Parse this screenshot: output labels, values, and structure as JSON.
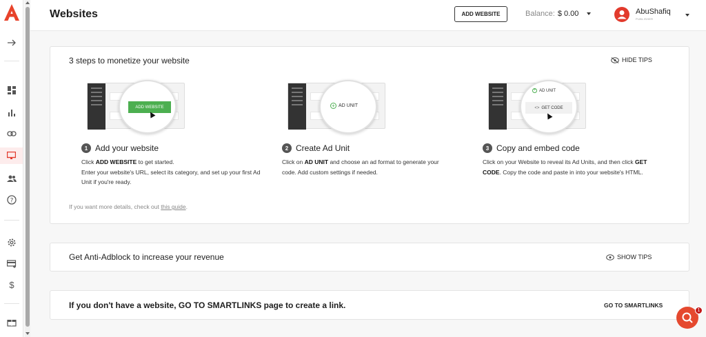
{
  "brand": {
    "logo_color": "#e8432b",
    "accent": "#e23a2c",
    "green": "#4caf50"
  },
  "sidebar": {
    "items": [
      {
        "icon": "arrow-right-icon"
      },
      {
        "icon": "dashboard-icon"
      },
      {
        "icon": "bar-chart-icon"
      },
      {
        "icon": "link-icon"
      },
      {
        "icon": "monitor-icon",
        "active": true
      },
      {
        "icon": "users-icon"
      },
      {
        "icon": "help-circle-icon"
      },
      {
        "icon": "gear-icon"
      },
      {
        "icon": "card-icon"
      },
      {
        "icon": "dollar-icon"
      },
      {
        "icon": "gift-icon"
      }
    ]
  },
  "header": {
    "title": "Websites",
    "add_website": "ADD WEBSITE",
    "balance_label": "Balance:",
    "balance_value": "$ 0.00",
    "user_name": "AbuShafiq",
    "user_role": "PUBLISHER"
  },
  "steps_card": {
    "title": "3 steps to monetize your website",
    "hide_tips": "HIDE TIPS",
    "steps": [
      {
        "num": "1",
        "title": "Add your website",
        "illus_label": "ADD WEBSITE",
        "line1_pre": "Click ",
        "line1_bold": "ADD WEBSITE",
        "line1_post": " to get started.",
        "line2": "Enter your website's URL, select its category, and set up your first Ad Unit if you're ready."
      },
      {
        "num": "2",
        "title": "Create Ad Unit",
        "illus_label": "AD UNIT",
        "line1_pre": "Click on ",
        "line1_bold": "AD UNIT",
        "line1_post": " and choose an ad format to generate your code. Add custom settings if needed."
      },
      {
        "num": "3",
        "title": "Copy and embed code",
        "illus_label": "AD UNIT",
        "illus_label2": "GET CODE",
        "line1_pre": "Click on your Website to reveal its Ad Units, and then click ",
        "line1_bold": "GET CODE",
        "line1_post": ". Copy the code and paste in into your website's HTML."
      }
    ],
    "more_pre": "If you want more details, check out ",
    "more_link": "this guide",
    "more_post": "."
  },
  "adblock_card": {
    "title": "Get Anti-Adblock to increase your revenue",
    "show_tips": "SHOW TIPS"
  },
  "smartlinks_card": {
    "title": "If you don't have a website, GO TO SMARTLINKS page to create a link.",
    "link": "GO TO SMARTLINKS"
  },
  "help": {
    "badge": "1"
  }
}
